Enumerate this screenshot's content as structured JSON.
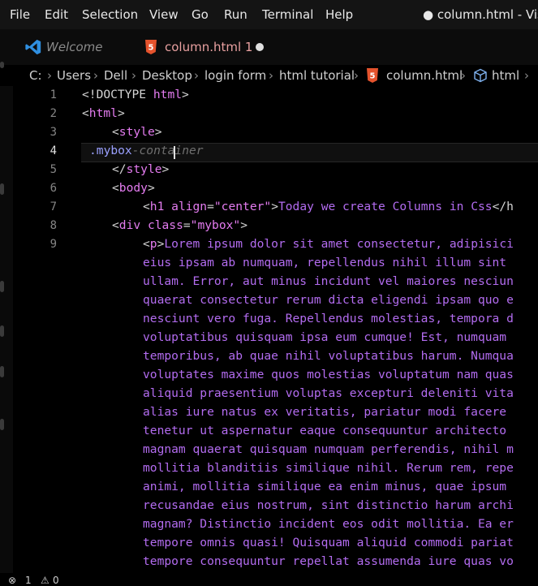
{
  "menu": [
    "File",
    "Edit",
    "Selection",
    "View",
    "Go",
    "Run",
    "Terminal",
    "Help"
  ],
  "window_title": "● column.html - Visua",
  "tabs": [
    {
      "label": "Welcome"
    },
    {
      "label": "column.html 1"
    }
  ],
  "breadcrumb": [
    "C:",
    "Users",
    "Dell",
    "Desktop",
    "login form",
    "html tutorial",
    "column.html",
    "html"
  ],
  "editor": {
    "active_line": "4",
    "lines": {
      "n1": "1",
      "n2": "2",
      "n3": "3",
      "n4": "4",
      "n5": "5",
      "n6": "6",
      "n7": "7",
      "n8": "8",
      "n9": "9",
      "l1a": "<!DOCTYPE ",
      "l1b": "html",
      "l1c": ">",
      "l2a": "<",
      "l2b": "html",
      "l2c": ">",
      "l3a": "<",
      "l3b": "style",
      "l3c": ">",
      "l4a": ".mybox",
      "l4b": "-container",
      "l5a": "</",
      "l5b": "style",
      "l5c": ">",
      "l6a": "<",
      "l6b": "body",
      "l6c": ">",
      "l7a": "<",
      "l7b": "h1",
      "l7c": " align",
      "l7d": "=",
      "l7e": "\"center\"",
      "l7f": ">",
      "l7g": "Today we create Columns in Css",
      "l7h": "</h",
      "l8a": "<",
      "l8b": "div",
      "l8c": " class",
      "l8d": "=",
      "l8e": "\"mybox\"",
      "l8f": ">",
      "l9a": "<",
      "l9b": "p",
      "l9c": ">",
      "p0": "Lorem ipsum dolor sit amet consectetur, adipisici",
      "p1": "eius ipsam ab numquam, repellendus nihil illum sint",
      "p2": "ullam. Error, aut minus incidunt vel maiores nesciun",
      "p3": "quaerat consectetur rerum dicta eligendi ipsam quo e",
      "p4": "nesciunt vero fuga. Repellendus molestias, tempora d",
      "p5": "voluptatibus quisquam ipsa eum cumque! Est, numquam",
      "p6": "temporibus, ab quae nihil voluptatibus harum. Numqua",
      "p7": "voluptates maxime quos molestias voluptatum nam quas",
      "p8": "aliquid praesentium voluptas excepturi deleniti vita",
      "p9": "alias iure natus ex veritatis, pariatur modi facere",
      "p10": "tenetur ut aspernatur eaque consequuntur architecto",
      "p11": "magnam quaerat quisquam numquam perferendis, nihil m",
      "p12": "mollitia blanditiis similique nihil. Rerum rem, repe",
      "p13": "animi, mollitia similique ea enim minus, quae ipsum",
      "p14": "recusandae eius nostrum, sint distinctio harum archi",
      "p15": "magnam? Distinctio incident eos odit mollitia. Ea er",
      "p16": "tempore omnis quasi! Quisquam aliquid commodi pariat",
      "p17": "tempore consequuntur repellat assumenda iure quas vo"
    }
  },
  "status": {
    "errors": "1",
    "warnings": "0"
  },
  "colors": {
    "tag": "#e47cf0",
    "text": "#b36cf0",
    "selector": "#9aa0ff",
    "background": "#000000"
  }
}
